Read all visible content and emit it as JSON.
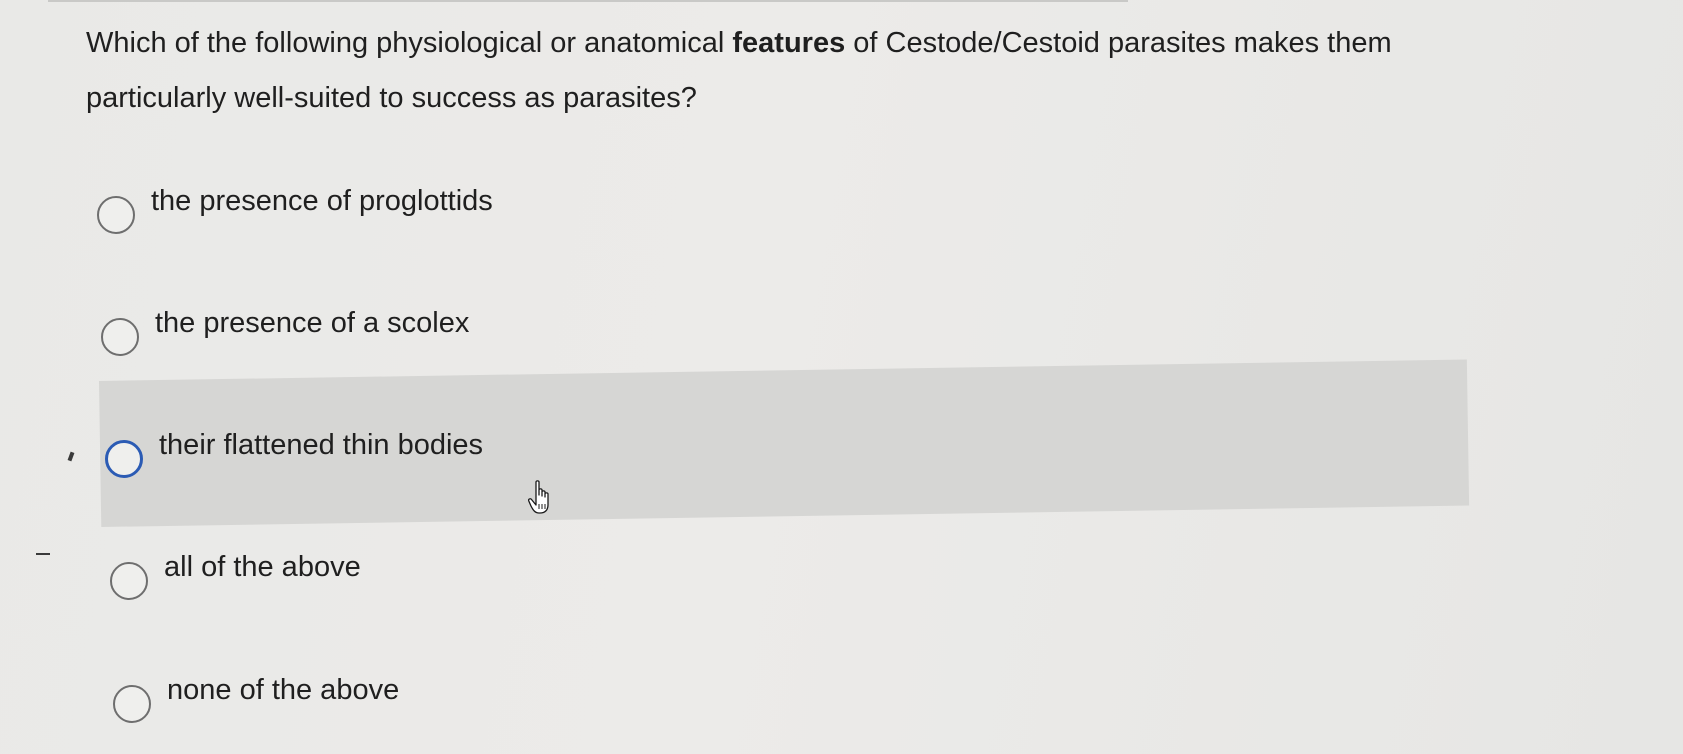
{
  "question": {
    "text_before": "Which of the following physiological or anatomical ",
    "text_bold": "features",
    "text_after": " of Cestode/Cestoid parasites makes them particularly well-suited to success as parasites?"
  },
  "options": [
    {
      "label": "the presence of proglottids",
      "selected": false,
      "focused": false
    },
    {
      "label": "the presence of a scolex",
      "selected": false,
      "focused": false
    },
    {
      "label": "their flattened thin bodies",
      "selected": false,
      "focused": true
    },
    {
      "label": "all of the above",
      "selected": false,
      "focused": false
    },
    {
      "label": "none of the above",
      "selected": false,
      "focused": false
    }
  ],
  "colors": {
    "focus_ring": "#2b5bb4",
    "hover_background": "#d6d6d4"
  },
  "icons": {
    "cursor": "hand-pointer-icon"
  }
}
